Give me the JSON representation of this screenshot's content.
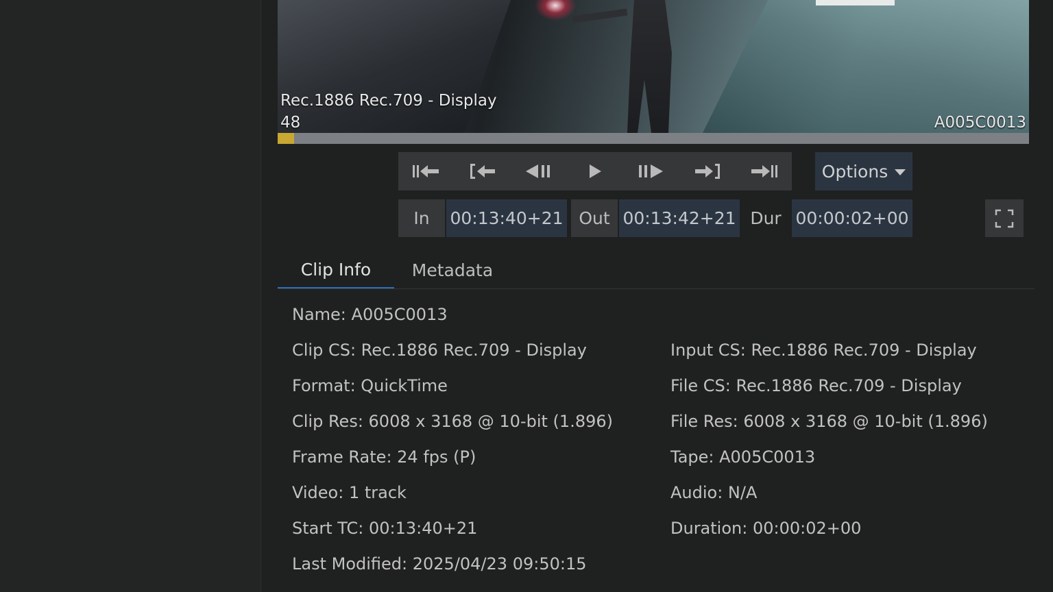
{
  "viewer": {
    "colorspace_overlay": "Rec.1886 Rec.709 - Display",
    "frame_overlay": "48",
    "clip_overlay": "A005C0013",
    "scrub_progress": 0.022
  },
  "transport": {
    "buttons": [
      {
        "name": "go-to-start",
        "icon": "skip-to-start-icon"
      },
      {
        "name": "go-to-in",
        "icon": "go-to-in-point-icon"
      },
      {
        "name": "step-back",
        "icon": "step-backward-icon"
      },
      {
        "name": "play",
        "icon": "play-icon"
      },
      {
        "name": "step-forward",
        "icon": "step-forward-icon"
      },
      {
        "name": "go-to-out",
        "icon": "go-to-out-point-icon"
      },
      {
        "name": "go-to-end",
        "icon": "skip-to-end-icon"
      }
    ],
    "options_label": "Options"
  },
  "timecode": {
    "in_label": "In",
    "in_value": "00:13:40+21",
    "out_label": "Out",
    "out_value": "00:13:42+21",
    "dur_label": "Dur",
    "dur_value": "00:00:02+00"
  },
  "tabs": [
    {
      "label": "Clip Info",
      "active": true
    },
    {
      "label": "Metadata",
      "active": false
    }
  ],
  "clip_info": {
    "name": "Name: A005C0013",
    "left": [
      "Clip CS: Rec.1886 Rec.709 - Display",
      "Format: QuickTime",
      "Clip Res: 6008 x 3168 @ 10-bit (1.896)",
      "Frame Rate: 24 fps (P)",
      "Video: 1 track",
      "Start TC: 00:13:40+21",
      "Last Modified: 2025/04/23 09:50:15"
    ],
    "right": [
      "Input CS: Rec.1886 Rec.709 - Display",
      "File CS: Rec.1886 Rec.709 - Display",
      "File Res: 6008 x 3168 @ 10-bit (1.896)",
      "Tape: A005C0013",
      "Audio: N/A",
      "Duration: 00:00:02+00"
    ]
  }
}
